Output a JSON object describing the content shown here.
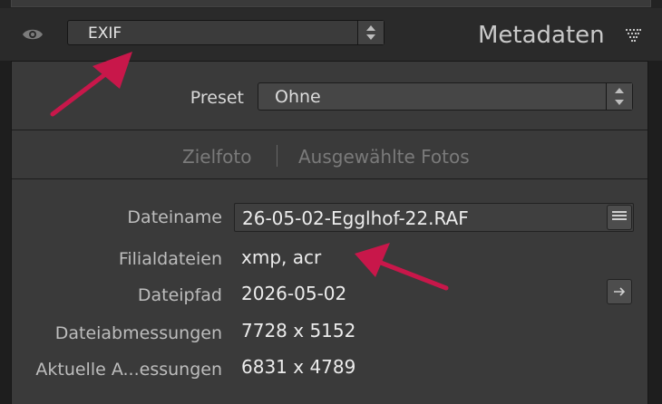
{
  "header": {
    "preset_value": "EXIF",
    "title": "Metadaten"
  },
  "preset_row": {
    "label": "Preset",
    "value": "Ohne"
  },
  "target_tabs": {
    "target_photo": "Zielfoto",
    "separator": "|",
    "selected_photos": "Ausgewählte Fotos"
  },
  "fields": [
    {
      "label": "Dateiname",
      "value": "26-05-02-Egglhof-22.RAF"
    },
    {
      "label": "Filialdateien",
      "value": "xmp, acr"
    },
    {
      "label": "Dateipfad",
      "value": "2026-05-02"
    },
    {
      "label": "Dateiabmessungen",
      "value": "7728 x 5152"
    },
    {
      "label": "Aktuelle A...essungen",
      "value": "6831 x 4789"
    }
  ],
  "icons": {
    "visibility": "eye-icon",
    "collapse": "triangle-collapse-icon",
    "filename_list": "list-icon",
    "goto_folder": "arrow-right-icon"
  },
  "colors": {
    "annotation_arrow": "#c8174a",
    "panel_bg": "#3a3a3a",
    "header_bg": "#2a2a2a"
  }
}
